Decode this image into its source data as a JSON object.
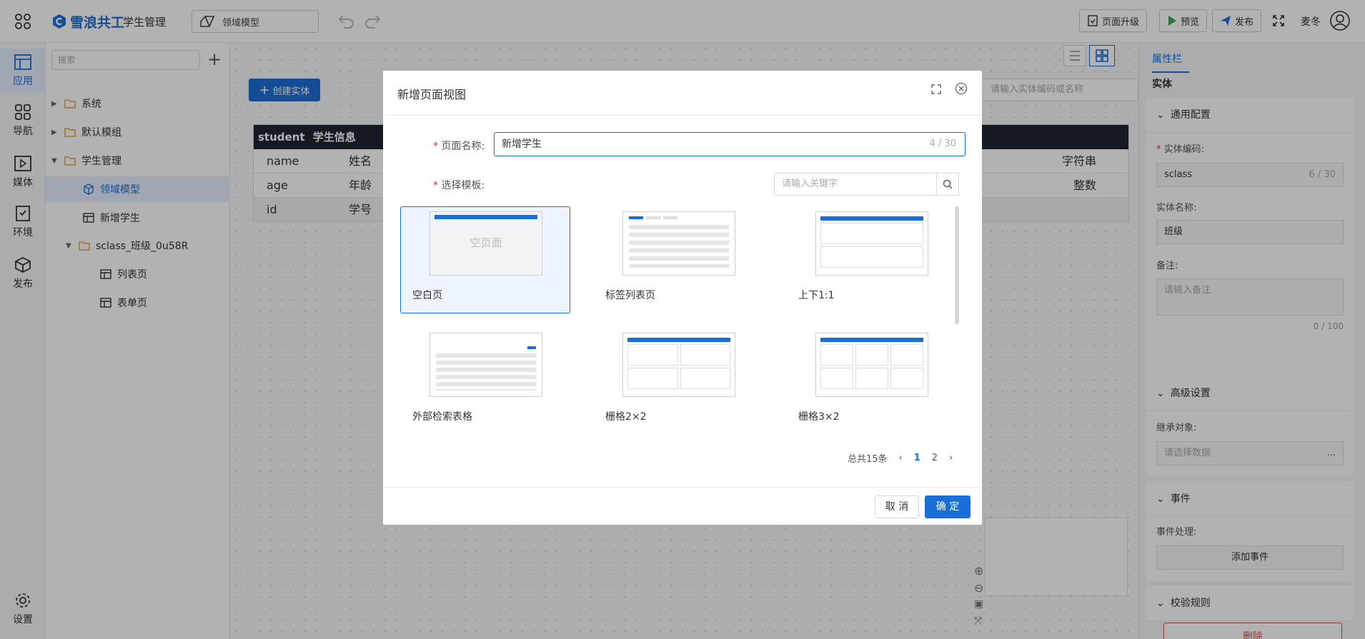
{
  "topbar": {
    "logo_text": "雪浪共工",
    "app_title": "学生管理",
    "model_select": "领域模型",
    "upgrade_label": "页面升级",
    "preview_label": "预览",
    "publish_label": "发布",
    "username": "麦冬"
  },
  "rail": {
    "items": [
      {
        "label": "应用",
        "icon": "app-icon"
      },
      {
        "label": "导航",
        "icon": "grid-icon"
      },
      {
        "label": "媒体",
        "icon": "media-icon"
      },
      {
        "label": "环境",
        "icon": "env-icon"
      },
      {
        "label": "发布",
        "icon": "cube-icon"
      }
    ],
    "settings_label": "设置"
  },
  "tree": {
    "search_placeholder": "搜索",
    "nodes": [
      {
        "label": "系统"
      },
      {
        "label": "默认模组"
      },
      {
        "label": "学生管理"
      },
      {
        "label": "领域模型"
      },
      {
        "label": "新增学生"
      },
      {
        "label": "sclass_班级_0u58R"
      },
      {
        "label": "列表页"
      },
      {
        "label": "表单页"
      }
    ]
  },
  "canvas": {
    "create_entity_label": "创建实体",
    "entity_search_placeholder": "请输入实体编码或名称",
    "entity": {
      "code": "student",
      "name": "学生信息",
      "rows": [
        {
          "field": "name",
          "label": "姓名",
          "type": "字符串"
        },
        {
          "field": "age",
          "label": "年龄",
          "type": "整数"
        },
        {
          "field": "id",
          "label": "学号",
          "type": ""
        }
      ]
    }
  },
  "props": {
    "tab_label": "属性栏",
    "entity_label": "实体",
    "general_section": "通用配置",
    "code_label": "实体编码:",
    "code_value": "sclass",
    "code_count": "6 / 30",
    "name_label": "实体名称:",
    "name_value": "班级",
    "remark_label": "备注:",
    "remark_placeholder": "请输入备注",
    "remark_count": "0 / 100",
    "advanced_section": "高级设置",
    "inherit_label": "继承对象:",
    "inherit_placeholder": "请选择数据",
    "inherit_more": "...",
    "event_section": "事件",
    "event_label": "事件处理:",
    "add_event_label": "添加事件",
    "validation_section": "校验规则",
    "delete_label": "删除"
  },
  "dialog": {
    "title": "新增页面视图",
    "name_label": "页面名称:",
    "name_value": "新增学生",
    "name_count": "4 / 30",
    "template_label": "选择模板:",
    "keyword_placeholder": "请输入关键字",
    "empty_thumb_text": "空页面",
    "templates": [
      {
        "name": "空白页",
        "selected": true
      },
      {
        "name": "标签列表页",
        "selected": false
      },
      {
        "name": "上下1:1",
        "selected": false
      },
      {
        "name": "外部检索表格",
        "selected": false
      },
      {
        "name": "栅格2×2",
        "selected": false
      },
      {
        "name": "栅格3×2",
        "selected": false
      }
    ],
    "pager": {
      "total": "总共15条",
      "pages": [
        "1",
        "2"
      ],
      "current": "1"
    },
    "cancel_label": "取 消",
    "ok_label": "确 定"
  },
  "colors": {
    "primary": "#1a6fd6",
    "danger": "#e14b4b",
    "overlay": "rgba(0,0,0,0.3)"
  }
}
